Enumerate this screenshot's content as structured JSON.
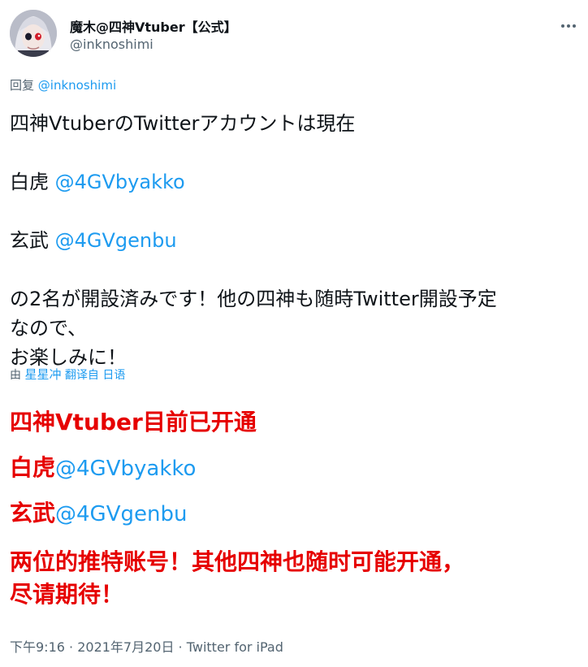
{
  "author": {
    "display_name": "魔木@四神Vtuber【公式】",
    "handle": "@inknoshimi"
  },
  "reply_prefix": "回复",
  "reply_to": "@inknoshimi",
  "tweet": {
    "line1": "四神VtuberのTwitterアカウントは現在",
    "byakko_label": "白虎",
    "byakko_handle": "@4GVbyakko",
    "genbu_label": "玄武",
    "genbu_handle": "@4GVgenbu",
    "line4": "の2名が開設済みです！他の四神も随時Twitter開設予定",
    "line5": "なので、",
    "line6": "お楽しみに！"
  },
  "translation": {
    "prefix": "由",
    "translator": "星星冲",
    "suffix": "翻译自 日语"
  },
  "translated": {
    "line1": "四神Vtuber目前已开通",
    "byakko_label": "白虎",
    "byakko_handle": "@4GVbyakko",
    "genbu_label": "玄武",
    "genbu_handle": "@4GVgenbu",
    "line4": "两位的推特账号！其他四神也随时可能开通，",
    "line5": "尽请期待！"
  },
  "meta": {
    "time": "下午9:16",
    "sep1": " · ",
    "date": "2021年7月20日",
    "sep2": " · ",
    "source": "Twitter for iPad"
  },
  "icons": {
    "avatar": "avatar-image",
    "more": "more-icon"
  },
  "colors": {
    "link": "#1d9bf0",
    "translated_text": "#e60000",
    "secondary": "#536471"
  }
}
